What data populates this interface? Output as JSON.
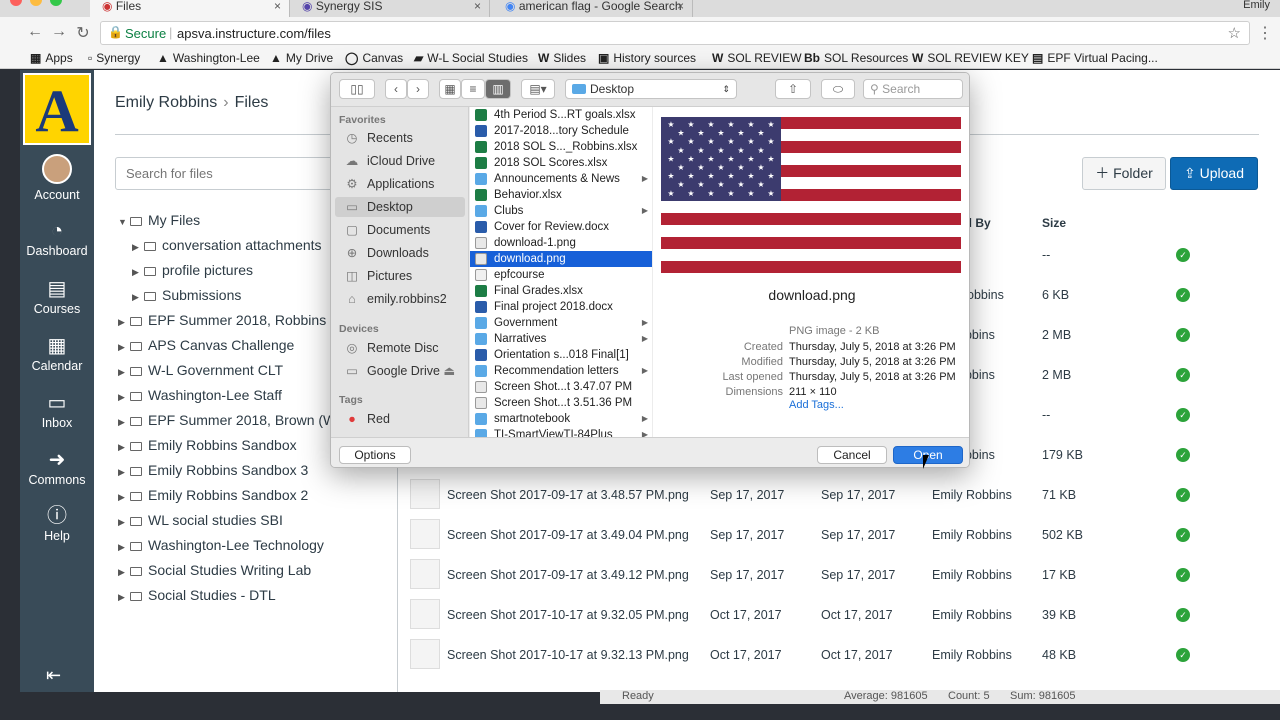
{
  "browser": {
    "tabs": [
      {
        "label": "Files",
        "active": true
      },
      {
        "label": "Synergy SIS"
      },
      {
        "label": "american flag - Google Search"
      }
    ],
    "user": "Emily",
    "secure": "Secure",
    "url": "apsva.instructure.com/files",
    "bookmarks": [
      "Apps",
      "Synergy",
      "Washington-Lee",
      "My Drive",
      "Canvas",
      "W-L Social Studies",
      "Slides",
      "History sources",
      "SOL REVIEW",
      "SOL Resources",
      "SOL REVIEW KEY",
      "EPF Virtual Pacing..."
    ]
  },
  "nav": {
    "account": "Account",
    "dashboard": "Dashboard",
    "courses": "Courses",
    "calendar": "Calendar",
    "inbox": "Inbox",
    "commons": "Commons",
    "help": "Help"
  },
  "breadcrumb": {
    "user": "Emily Robbins",
    "page": "Files"
  },
  "files": {
    "search_placeholder": "Search for files",
    "folder_btn": "Folder",
    "upload_btn": "Upload",
    "col_modified_by": "ed By",
    "col_size": "Size",
    "tree": [
      {
        "label": "My Files",
        "level": 0,
        "open": true
      },
      {
        "label": "conversation attachments",
        "level": 1
      },
      {
        "label": "profile pictures",
        "level": 1
      },
      {
        "label": "Submissions",
        "level": 1
      },
      {
        "label": "EPF Summer 2018, Robbins",
        "level": 0
      },
      {
        "label": "APS Canvas Challenge",
        "level": 0
      },
      {
        "label": "W-L Government CLT",
        "level": 0
      },
      {
        "label": "Washington-Lee Staff",
        "level": 0
      },
      {
        "label": "EPF Summer 2018, Brown (W",
        "level": 0
      },
      {
        "label": "Emily Robbins Sandbox",
        "level": 0
      },
      {
        "label": "Emily Robbins Sandbox 3",
        "level": 0
      },
      {
        "label": "Emily Robbins Sandbox 2",
        "level": 0
      },
      {
        "label": "WL social studies SBI",
        "level": 0
      },
      {
        "label": "Washington-Lee Technology",
        "level": 0
      },
      {
        "label": "Social Studies Writing Lab",
        "level": 0
      },
      {
        "label": "Social Studies - DTL",
        "level": 0
      }
    ],
    "partial_rows": [
      {
        "by": "",
        "size": "--"
      },
      {
        "by": "Robbins",
        "size": "6 KB"
      },
      {
        "by": "obbins",
        "size": "2 MB"
      },
      {
        "by": "obbins",
        "size": "2 MB"
      },
      {
        "by": "",
        "size": "--"
      },
      {
        "by": "obbins",
        "size": "179 KB"
      }
    ],
    "rows": [
      {
        "name": "Screen Shot 2017-09-17 at 3.48.57 PM.png",
        "created": "Sep 17, 2017",
        "modified": "Sep 17, 2017",
        "by": "Emily Robbins",
        "size": "71 KB"
      },
      {
        "name": "Screen Shot 2017-09-17 at 3.49.04 PM.png",
        "created": "Sep 17, 2017",
        "modified": "Sep 17, 2017",
        "by": "Emily Robbins",
        "size": "502 KB"
      },
      {
        "name": "Screen Shot 2017-09-17 at 3.49.12 PM.png",
        "created": "Sep 17, 2017",
        "modified": "Sep 17, 2017",
        "by": "Emily Robbins",
        "size": "17 KB"
      },
      {
        "name": "Screen Shot 2017-10-17 at 9.32.05 PM.png",
        "created": "Oct 17, 2017",
        "modified": "Oct 17, 2017",
        "by": "Emily Robbins",
        "size": "39 KB"
      },
      {
        "name": "Screen Shot 2017-10-17 at 9.32.13 PM.png",
        "created": "Oct 17, 2017",
        "modified": "Oct 17, 2017",
        "by": "Emily Robbins",
        "size": "48 KB"
      }
    ]
  },
  "statusbar": {
    "ready": "Ready",
    "average": "Average: 981605",
    "count": "Count: 5",
    "sum": "Sum: 981605"
  },
  "dialog": {
    "location": "Desktop",
    "search_placeholder": "Search",
    "favorites_label": "Favorites",
    "favorites": [
      "Recents",
      "iCloud Drive",
      "Applications",
      "Desktop",
      "Documents",
      "Downloads",
      "Pictures",
      "emily.robbins2"
    ],
    "devices_label": "Devices",
    "devices": [
      "Remote Disc",
      "Google Drive"
    ],
    "tags_label": "Tags",
    "tags": [
      "Red"
    ],
    "files": [
      {
        "name": "4th Period S...RT goals.xlsx",
        "type": "xlsx"
      },
      {
        "name": "2017-2018...tory Schedule",
        "type": "docx"
      },
      {
        "name": "2018 SOL S..._Robbins.xlsx",
        "type": "xlsx"
      },
      {
        "name": "2018 SOL Scores.xlsx",
        "type": "xlsx"
      },
      {
        "name": "Announcements & News",
        "type": "folder",
        "has_children": true
      },
      {
        "name": "Behavior.xlsx",
        "type": "xlsx"
      },
      {
        "name": "Clubs",
        "type": "folder",
        "has_children": true
      },
      {
        "name": "Cover for Review.docx",
        "type": "docx"
      },
      {
        "name": "download-1.png",
        "type": "png"
      },
      {
        "name": "download.png",
        "type": "png",
        "selected": true
      },
      {
        "name": "epfcourse",
        "type": "file"
      },
      {
        "name": "Final Grades.xlsx",
        "type": "xlsx"
      },
      {
        "name": "Final project 2018.docx",
        "type": "docx"
      },
      {
        "name": "Government",
        "type": "folder",
        "has_children": true
      },
      {
        "name": "Narratives",
        "type": "folder",
        "has_children": true
      },
      {
        "name": "Orientation s...018 Final[1]",
        "type": "docx"
      },
      {
        "name": "Recommendation letters",
        "type": "folder",
        "has_children": true
      },
      {
        "name": "Screen Shot...t 3.47.07 PM",
        "type": "png"
      },
      {
        "name": "Screen Shot...t 3.51.36 PM",
        "type": "png"
      },
      {
        "name": "smartnotebook",
        "type": "folder",
        "has_children": true
      },
      {
        "name": "TI-SmartViewTI-84Plus",
        "type": "folder",
        "has_children": true
      }
    ],
    "preview": {
      "name": "download.png",
      "kind": "PNG image - 2 KB",
      "created_label": "Created",
      "created": "Thursday, July 5, 2018 at 3:26 PM",
      "modified_label": "Modified",
      "modified": "Thursday, July 5, 2018 at 3:26 PM",
      "opened_label": "Last opened",
      "opened": "Thursday, July 5, 2018 at 3:26 PM",
      "dims_label": "Dimensions",
      "dims": "211 × 110",
      "add_tags": "Add Tags..."
    },
    "options_btn": "Options",
    "cancel_btn": "Cancel",
    "open_btn": "Open"
  },
  "colors": {
    "canvas_nav": "#394b58",
    "upload": "#0e6bb5",
    "select": "#1760d8",
    "ok": "#2ca33a",
    "flag_red": "#b22234",
    "flag_blue": "#3c3b6e"
  }
}
